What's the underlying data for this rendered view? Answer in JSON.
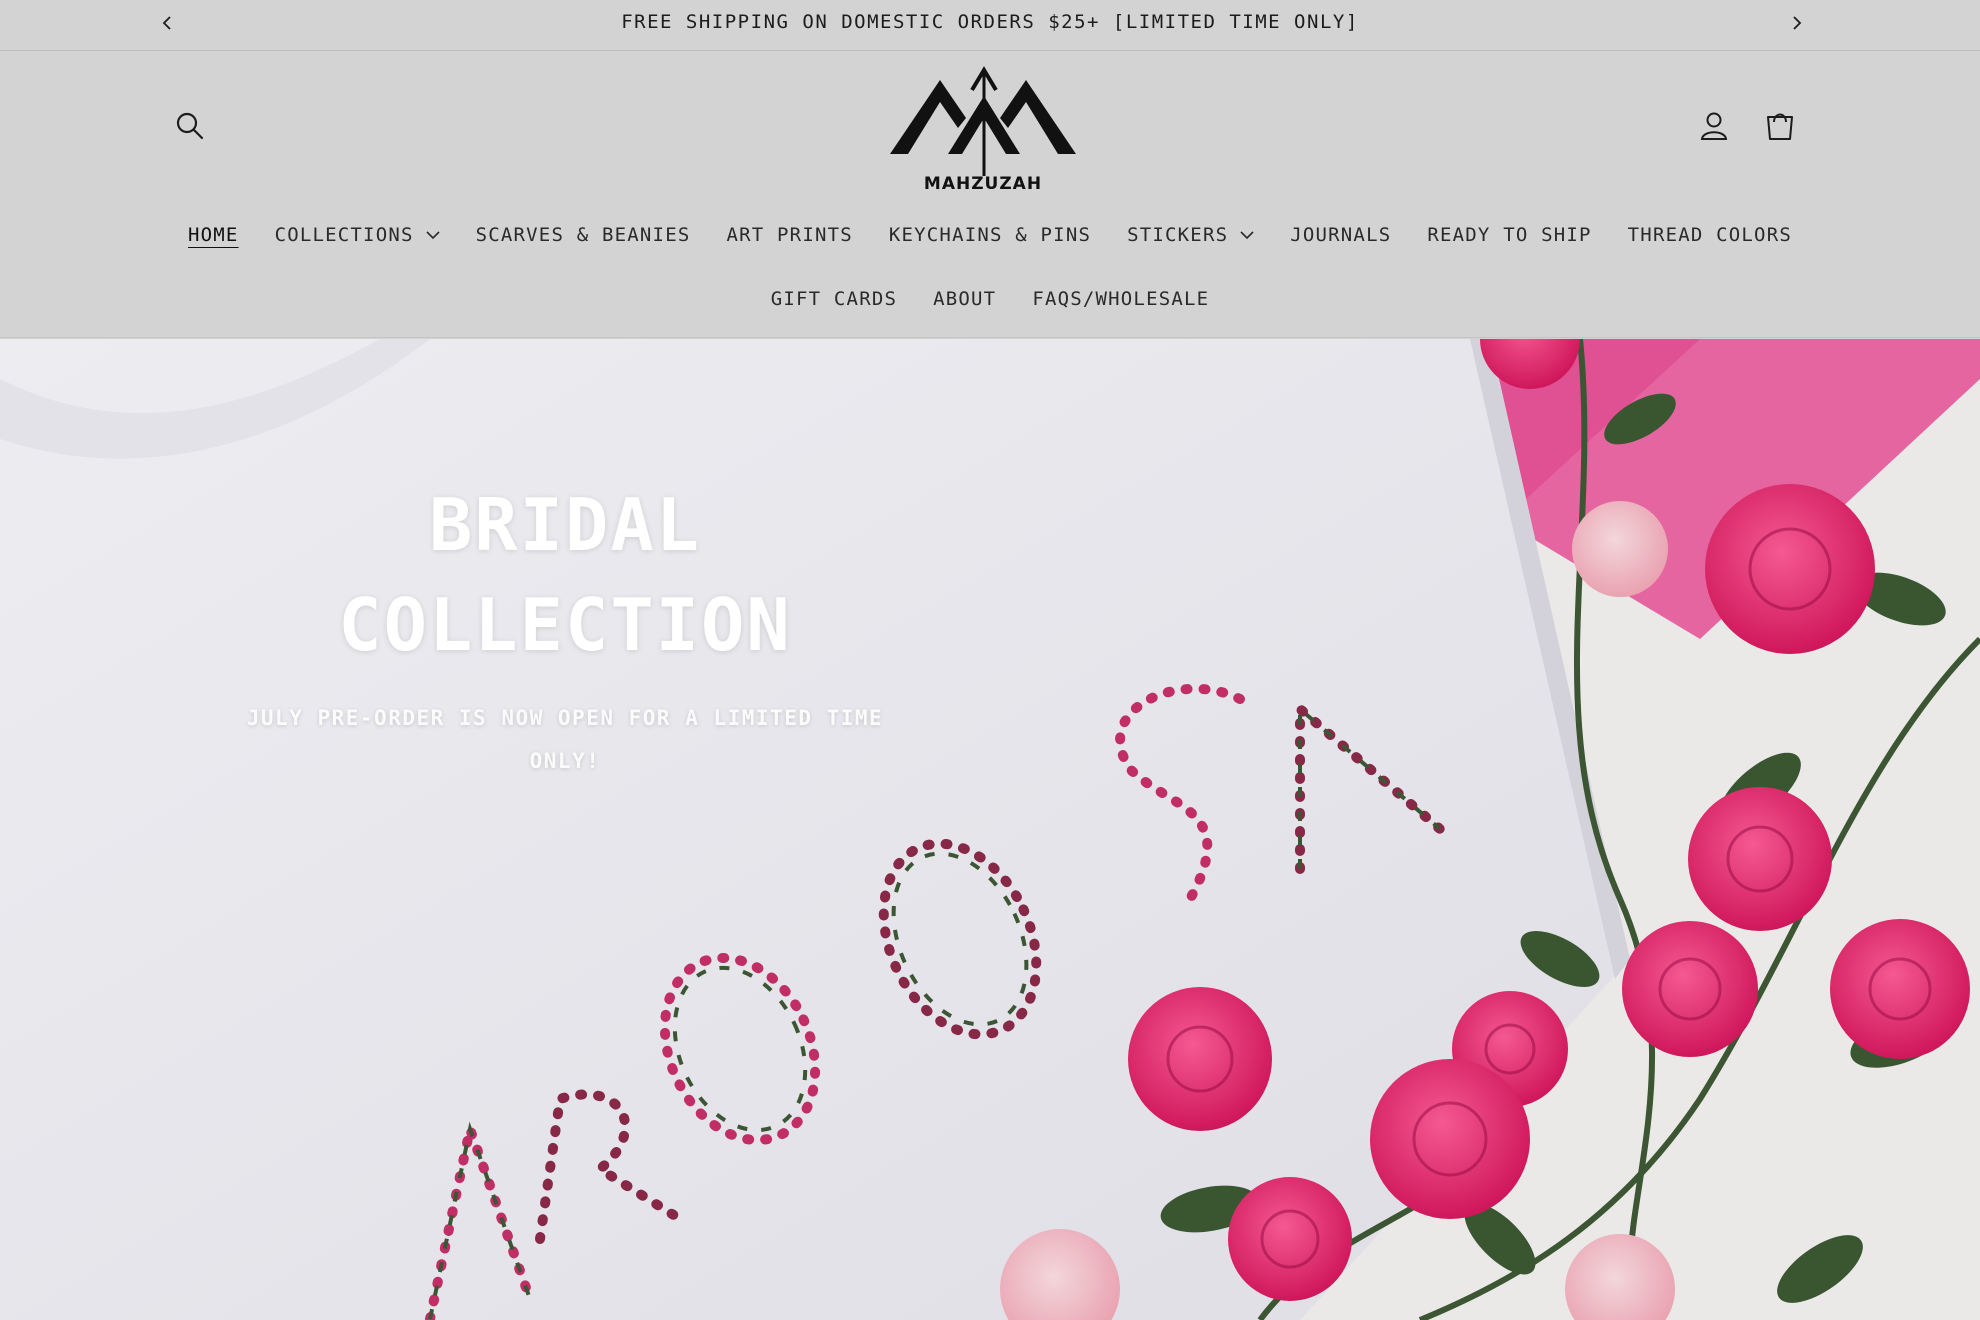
{
  "announcement": {
    "text": "FREE SHIPPING ON DOMESTIC ORDERS $25+ [LIMITED TIME ONLY]",
    "prev_icon": "chevron-left-icon",
    "next_icon": "chevron-right-icon"
  },
  "header": {
    "brand": "MAHZUZAH",
    "icons": {
      "search": "search-icon",
      "account": "user-icon",
      "cart": "cart-icon"
    }
  },
  "nav": {
    "row1": [
      {
        "label": "HOME",
        "active": true
      },
      {
        "label": "COLLECTIONS",
        "dropdown": true
      },
      {
        "label": "SCARVES & BEANIES"
      },
      {
        "label": "ART PRINTS"
      },
      {
        "label": "KEYCHAINS & PINS"
      },
      {
        "label": "STICKERS",
        "dropdown": true
      },
      {
        "label": "JOURNALS"
      },
      {
        "label": "READY TO SHIP"
      },
      {
        "label": "THREAD COLORS"
      }
    ],
    "row2": [
      {
        "label": "GIFT CARDS"
      },
      {
        "label": "ABOUT"
      },
      {
        "label": "FAQS/WHOLESALE"
      }
    ]
  },
  "hero": {
    "title_line1": "BRIDAL",
    "title_line2": "COLLECTION",
    "subtitle_line1": "JULY PRE-ORDER IS NOW OPEN FOR A LIMITED TIME",
    "subtitle_line2": "ONLY!",
    "image_icon": "embroidered-sweatshirt-photo"
  },
  "colors": {
    "header_bg": "#d3d3d3",
    "text": "#1c1c1c",
    "pink_backdrop": "#e9559a",
    "rose": "#f2377a",
    "leaf": "#3f5a36"
  }
}
